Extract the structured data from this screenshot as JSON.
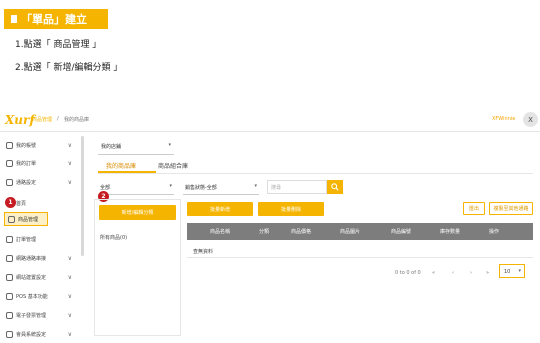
{
  "instructions": {
    "title": "「單品」建立",
    "step1": "1.點選「 商品管理 」",
    "step2": "2.點選「 新增/編輯分類 」"
  },
  "app": {
    "logo": "Xurf",
    "breadcrumb": {
      "home": "商品管理",
      "separator": "/",
      "current": "我的商品庫"
    },
    "username": "XFWinnie",
    "avatar": "X"
  },
  "sidebar": {
    "items": [
      {
        "label": "我的帳號",
        "chevron": "∨"
      },
      {
        "label": "我的訂單",
        "chevron": "∨"
      },
      {
        "label": "通路設定",
        "chevron": "∨"
      },
      {
        "label": "首頁",
        "chevron": ""
      },
      {
        "label": "商品管理",
        "chevron": ""
      },
      {
        "label": "訂單管理",
        "chevron": ""
      },
      {
        "label": "網路通路串接",
        "chevron": "∨"
      },
      {
        "label": "網站建置設定",
        "chevron": "∨"
      },
      {
        "label": "POS 基本功能",
        "chevron": "∨"
      },
      {
        "label": "電子發票管理",
        "chevron": "∨"
      },
      {
        "label": "會員系統設定",
        "chevron": "∨"
      }
    ]
  },
  "callouts": {
    "one": "1",
    "two": "2"
  },
  "main": {
    "shop_select": "我的店鋪",
    "tabs": [
      "我的商品庫",
      "商品組合庫"
    ],
    "add_category_button": "新增/編輯分類",
    "category_item": "所有商品(0)",
    "filter_category": "全部",
    "filter_status": "銷售狀態-全部",
    "search_placeholder": "搜尋",
    "batch_buttons": [
      "批量新增",
      "批量刪除"
    ],
    "right_buttons": [
      "匯出",
      "複製至其他通路"
    ],
    "table_headers": [
      "商品名稱",
      "分類",
      "商品價格",
      "商品圖片",
      "商品編號",
      "庫存數量",
      "操作"
    ],
    "empty_text": "查無資料",
    "pagination": {
      "range": "0 to 0 of 0",
      "first": "«",
      "prev": "‹",
      "next": "›",
      "last": "»",
      "page_size": "10"
    }
  },
  "colors": {
    "accent": "#f5b400",
    "callout": "#c61b22",
    "table_header": "#7d7d7d"
  }
}
